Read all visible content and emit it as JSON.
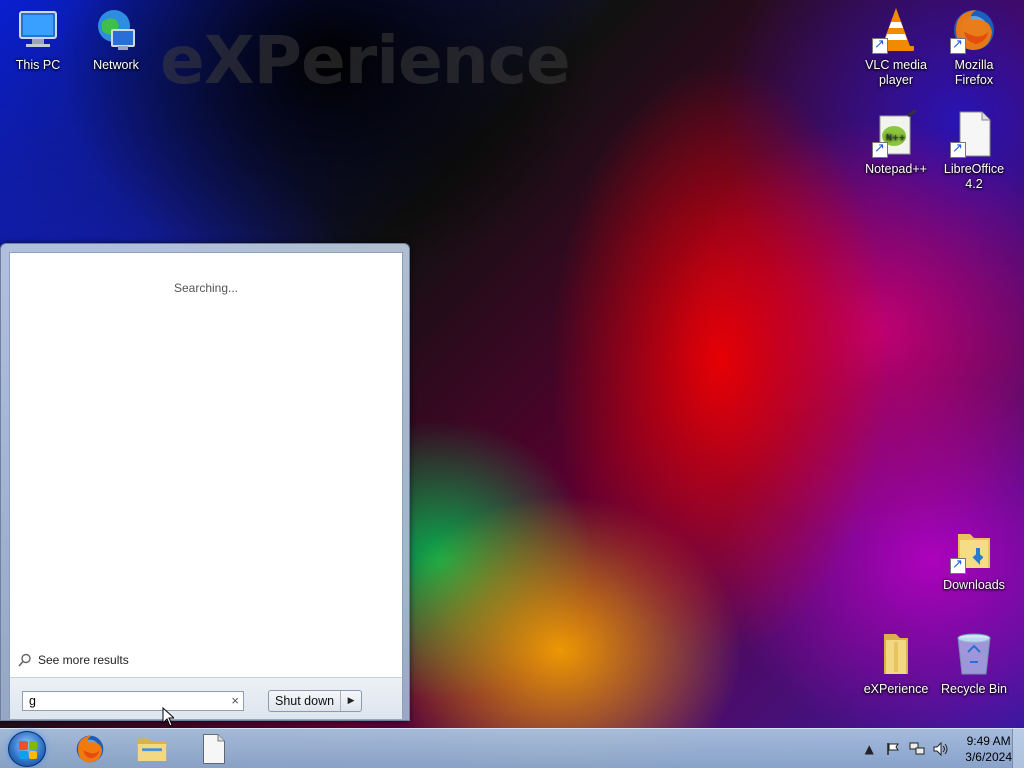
{
  "wallpaper": {
    "watermark": "eXPerience"
  },
  "desktop_icons_left": [
    {
      "label": "This PC",
      "icon": "computer-icon"
    },
    {
      "label": "Network",
      "icon": "network-icon"
    }
  ],
  "desktop_icons_right": [
    {
      "label": "VLC media player",
      "icon": "vlc-icon"
    },
    {
      "label": "Mozilla Firefox",
      "icon": "firefox-icon"
    },
    {
      "label": "Notepad++",
      "icon": "notepad-plus-plus-icon"
    },
    {
      "label": "LibreOffice 4.2",
      "icon": "libreoffice-icon"
    },
    {
      "label": "Downloads",
      "icon": "downloads-folder-icon"
    },
    {
      "label": "eXPerience",
      "icon": "folder-icon"
    },
    {
      "label": "Recycle Bin",
      "icon": "recycle-bin-icon"
    }
  ],
  "start_menu": {
    "status": "Searching...",
    "see_more": "See more results",
    "search_value": "g",
    "search_clear": "×",
    "shutdown_label": "Shut down",
    "shutdown_arrow": "▶"
  },
  "taskbar": {
    "pinned": [
      {
        "name": "firefox",
        "icon": "firefox-icon"
      },
      {
        "name": "file-explorer",
        "icon": "folder-icon"
      },
      {
        "name": "libreoffice",
        "icon": "libreoffice-icon"
      }
    ],
    "clock_time": "9:49 AM",
    "clock_date": "3/6/2024"
  }
}
